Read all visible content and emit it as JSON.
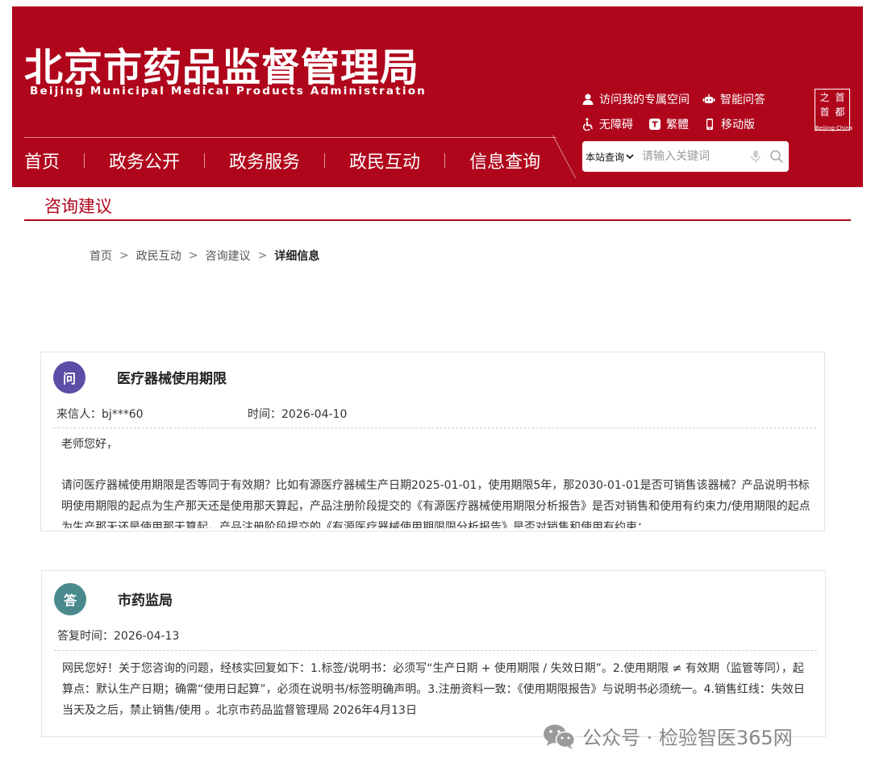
{
  "header": {
    "logo_cn": "北京市药品监督管理局",
    "logo_en": "Beijing Municipal Medical Products Administration",
    "utilities": {
      "my_space": "访问我的专属空间",
      "smart_qa": "智能问答",
      "accessibility": "无障碍",
      "traditional": "繁體",
      "mobile": "移动版"
    },
    "emblem": {
      "chars": [
        "之",
        "首",
        "首",
        "都"
      ],
      "sub": "Beijing·China"
    },
    "nav": [
      "首页",
      "政务公开",
      "政务服务",
      "政民互动",
      "信息查询"
    ],
    "search": {
      "scope": "本站查询",
      "placeholder": "请输入关键词"
    }
  },
  "section": {
    "title": "咨询建议"
  },
  "breadcrumb": [
    "首页",
    "政民互动",
    "咨询建议",
    "详细信息"
  ],
  "question": {
    "badge": "问",
    "title": "医疗器械使用期限",
    "sender": "来信人：bj***60",
    "time": "时间：2026-04-10",
    "greeting": "老师您好，",
    "content": "请问医疗器械使用期限是否等同于有效期？比如有源医疗器械生产日期2025-01-01，使用期限5年，那2030-01-01是否可销售该器械？产品说明书标明使用期限的起点为生产那天还是使用那天算起，产品注册阶段提交的《有源医疗器械使用期限分析报告》是否对销售和使用有约束力/使用期限的起点为生产那天还是使用那天算起，产品注册阶段提交的《有源医疗器械使用期限限分析报告》是否对销售和使用有约束："
  },
  "answer": {
    "badge": "答",
    "title": "市药监局",
    "reply_time": "答复时间：2026-04-13",
    "content": "网民您好！关于您咨询的问题，经核实回复如下：1.标签/说明书：必须写“生产日期 + 使用期限 / 失效日期”。2.使用期限 ≠ 有效期（监管等同），起算点：默认生产日期；确需“使用日起算”，必须在说明书/标签明确声明。3.注册资料一致：《使用期限报告》与说明书必须统一。4.销售红线：失效日当天及之后，禁止销售/使用 。北京市药品监督管理局  2026年4月13日"
  },
  "watermark": "公众号 · 检验智医365网",
  "colors": {
    "brand_red": "#b0061c",
    "question_badge": "#5a4ea6",
    "answer_badge": "#4a8a8d"
  }
}
